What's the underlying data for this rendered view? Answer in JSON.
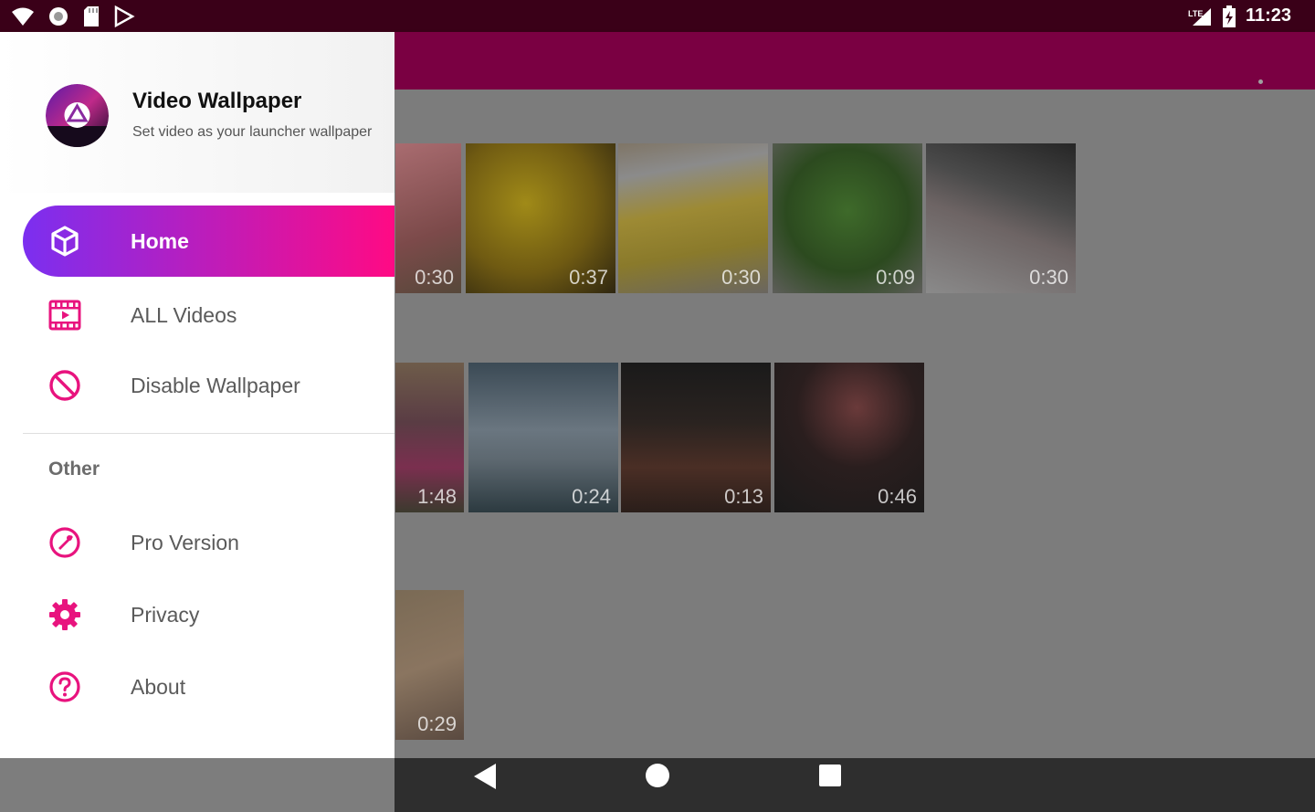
{
  "status_bar": {
    "time": "11:23",
    "network": "LTE",
    "left_icons": [
      "wifi-icon",
      "sync-icon",
      "sd-card-icon",
      "play-store-icon"
    ],
    "right_icons": [
      "signal-icon",
      "battery-charging-icon"
    ]
  },
  "drawer": {
    "app_name": "Video Wallpaper",
    "tagline": "Set video as your launcher wallpaper",
    "items": [
      {
        "label": "Home",
        "icon": "cube-icon",
        "active": true
      },
      {
        "label": "ALL Videos",
        "icon": "film-icon",
        "active": false
      },
      {
        "label": "Disable Wallpaper",
        "icon": "block-icon",
        "active": false
      }
    ],
    "section_title": "Other",
    "other_items": [
      {
        "label": "Pro Version",
        "icon": "pro-badge-icon"
      },
      {
        "label": "Privacy",
        "icon": "gear-icon"
      },
      {
        "label": "About",
        "icon": "help-circle-icon"
      }
    ]
  },
  "videos": {
    "row1": [
      "0:30",
      "0:37",
      "0:30",
      "0:09",
      "0:30"
    ],
    "row2": [
      "1:48",
      "0:24",
      "0:13",
      "0:46"
    ],
    "row3": [
      "0:29"
    ]
  },
  "colors": {
    "accent_start": "#7b2ff0",
    "accent_end": "#ff0a84",
    "icon_pink": "#e8137e",
    "app_bar": "#7a0042",
    "status_bar": "#3a0018"
  }
}
